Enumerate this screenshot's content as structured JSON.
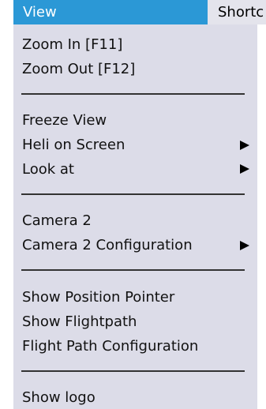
{
  "menubar": {
    "view_label": "View",
    "shortcuts_label": "Shortc"
  },
  "menu": {
    "zoom_in": "Zoom In [F11]",
    "zoom_out": "Zoom Out [F12]",
    "freeze_view": "Freeze View",
    "heli_on_screen": "Heli on Screen",
    "look_at": "Look at",
    "camera2": "Camera 2",
    "camera2_config": "Camera 2 Configuration",
    "show_position_pointer": "Show Position Pointer",
    "show_flightpath": "Show Flightpath",
    "flight_path_config": "Flight Path Configuration",
    "show_logo": "Show logo"
  },
  "colors": {
    "menu_bg": "#dcdce8",
    "selected_bg": "#2b98d6"
  },
  "icons": {
    "submenu": "submenu-arrow-icon"
  }
}
